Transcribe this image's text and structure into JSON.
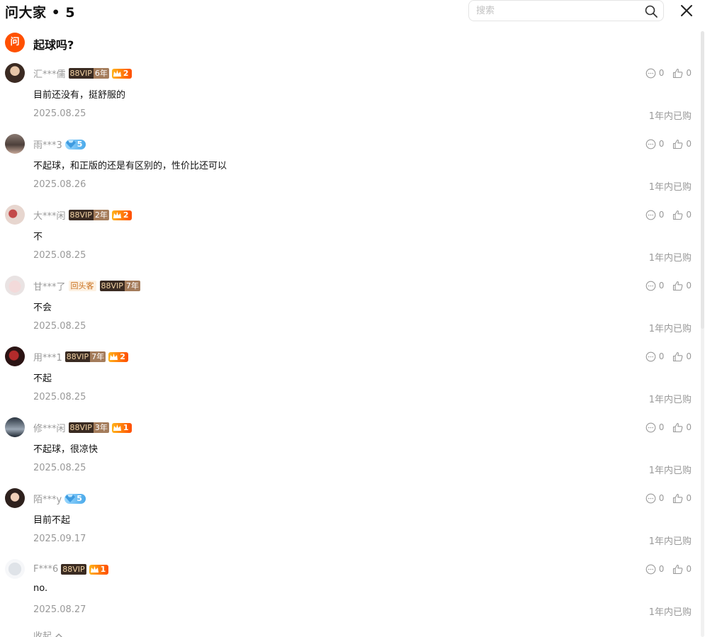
{
  "header": {
    "title": "问大家 • 5",
    "search_placeholder": "搜索"
  },
  "question": {
    "badge": "问",
    "text": "起球吗?"
  },
  "answers": [
    {
      "user": "汇***儒",
      "vip": "88VIP",
      "vip_years": "6年",
      "crown_level": "2",
      "content": "目前还没有，挺舒服的",
      "date": "2025.08.25",
      "purchase": "1年内已购",
      "reply_count": "0",
      "like_count": "0"
    },
    {
      "user": "雨***3",
      "diamond_level": "5",
      "content": "不起球，和正版的还是有区别的，性价比还可以",
      "date": "2025.08.26",
      "purchase": "1年内已购",
      "reply_count": "0",
      "like_count": "0"
    },
    {
      "user": "大***闲",
      "vip": "88VIP",
      "vip_years": "2年",
      "crown_level": "2",
      "content": "不",
      "date": "2025.08.25",
      "purchase": "1年内已购",
      "reply_count": "0",
      "like_count": "0"
    },
    {
      "user": "甘***了",
      "return_tag": "回头客",
      "vip": "88VIP",
      "vip_years": "7年",
      "content": "不会",
      "date": "2025.08.25",
      "purchase": "1年内已购",
      "reply_count": "0",
      "like_count": "0"
    },
    {
      "user": "用***1",
      "vip": "88VIP",
      "vip_years": "7年",
      "crown_level": "2",
      "content": "不起",
      "date": "2025.08.25",
      "purchase": "1年内已购",
      "reply_count": "0",
      "like_count": "0"
    },
    {
      "user": "修***闲",
      "vip": "88VIP",
      "vip_years": "3年",
      "crown_level": "1",
      "content": "不起球，很凉快",
      "date": "2025.08.25",
      "purchase": "1年内已购",
      "reply_count": "0",
      "like_count": "0"
    },
    {
      "user": "陌***y",
      "diamond_level": "5",
      "content": "目前不起",
      "date": "2025.09.17",
      "purchase": "1年内已购",
      "reply_count": "0",
      "like_count": "0"
    },
    {
      "user": "F***6",
      "vip": "88VIP",
      "crown_level": "1",
      "content": "no.",
      "date": "2025.08.27",
      "purchase": "1年内已购",
      "reply_count": "0",
      "like_count": "0"
    }
  ],
  "collapse_label": "收起",
  "colors": {
    "accent": "#ff5000",
    "muted_text": "#999999",
    "vip_dark": "#3a2b22",
    "vip_light": "#a47c5b"
  },
  "icons": {
    "search": "search-icon",
    "close": "close-icon",
    "reply": "comment-bubble-icon",
    "like": "thumbs-up-icon",
    "collapse": "chevron-up-icon"
  }
}
